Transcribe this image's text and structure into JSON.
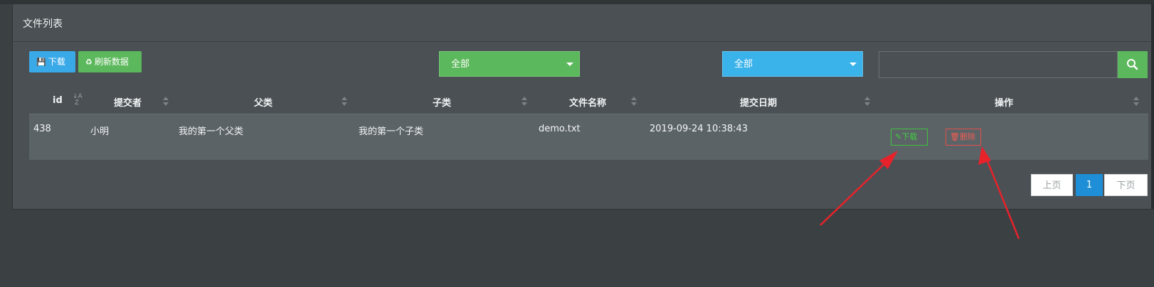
{
  "panel": {
    "title": "文件列表"
  },
  "toolbar": {
    "download_label": "下载",
    "refresh_label": "刷新数据",
    "category_select": "全部",
    "subcategory_select": "全部",
    "search_placeholder": ""
  },
  "table": {
    "headers": [
      "id",
      "提交者",
      "父类",
      "子类",
      "文件名称",
      "提交日期",
      "操作"
    ],
    "rows": [
      {
        "id": "438",
        "submitter": "小明",
        "parent": "我的第一个父类",
        "child": "我的第一个子类",
        "filename": "demo.txt",
        "date": "2019-09-24 10:38:43",
        "download_label": "下载",
        "delete_label": "删除"
      }
    ]
  },
  "pagination": {
    "prev": "上页",
    "current": "1",
    "next": "下页"
  },
  "icons": {
    "download": "floppy-icon",
    "refresh": "recycle-icon",
    "search": "search-icon",
    "edit": "pencil-icon",
    "delete": "trash-icon"
  },
  "colors": {
    "green": "#5cb85c",
    "blue": "#3ab2ea",
    "annotation_arrow": "#e8222a"
  }
}
